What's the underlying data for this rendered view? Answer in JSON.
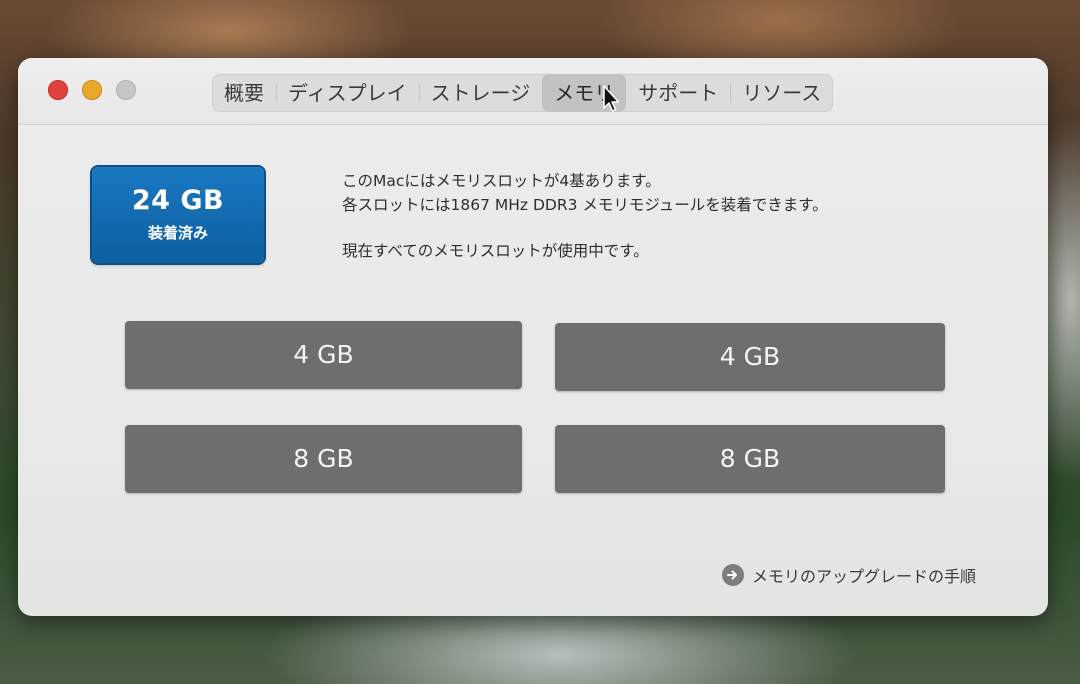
{
  "window": {
    "tabs": [
      {
        "label": "概要",
        "active": false
      },
      {
        "label": "ディスプレイ",
        "active": false
      },
      {
        "label": "ストレージ",
        "active": false
      },
      {
        "label": "メモリ",
        "active": true
      },
      {
        "label": "サポート",
        "active": false
      },
      {
        "label": "リソース",
        "active": false
      }
    ]
  },
  "memory": {
    "installed_amount": "24 GB",
    "installed_caption": "装着済み",
    "info_line1": "このMacにはメモリスロットが4基あります。",
    "info_line2": "各スロットには1867 MHz DDR3 メモリモジュールを装着できます。",
    "info_line3": "現在すべてのメモリスロットが使用中です。",
    "slots": [
      "4 GB",
      "4 GB",
      "8 GB",
      "8 GB"
    ],
    "upgrade_link": "メモリのアップグレードの手順"
  },
  "colors": {
    "installed_badge": "#1a78c2",
    "slot_fill": "#6e6e6e",
    "close": "#e0433b",
    "minimize": "#e8a82a",
    "zoom": "#c6c6c6"
  },
  "icons": [
    "close-icon",
    "minimize-icon",
    "zoom-icon",
    "arrow-right-circle-icon",
    "mouse-pointer-icon"
  ]
}
